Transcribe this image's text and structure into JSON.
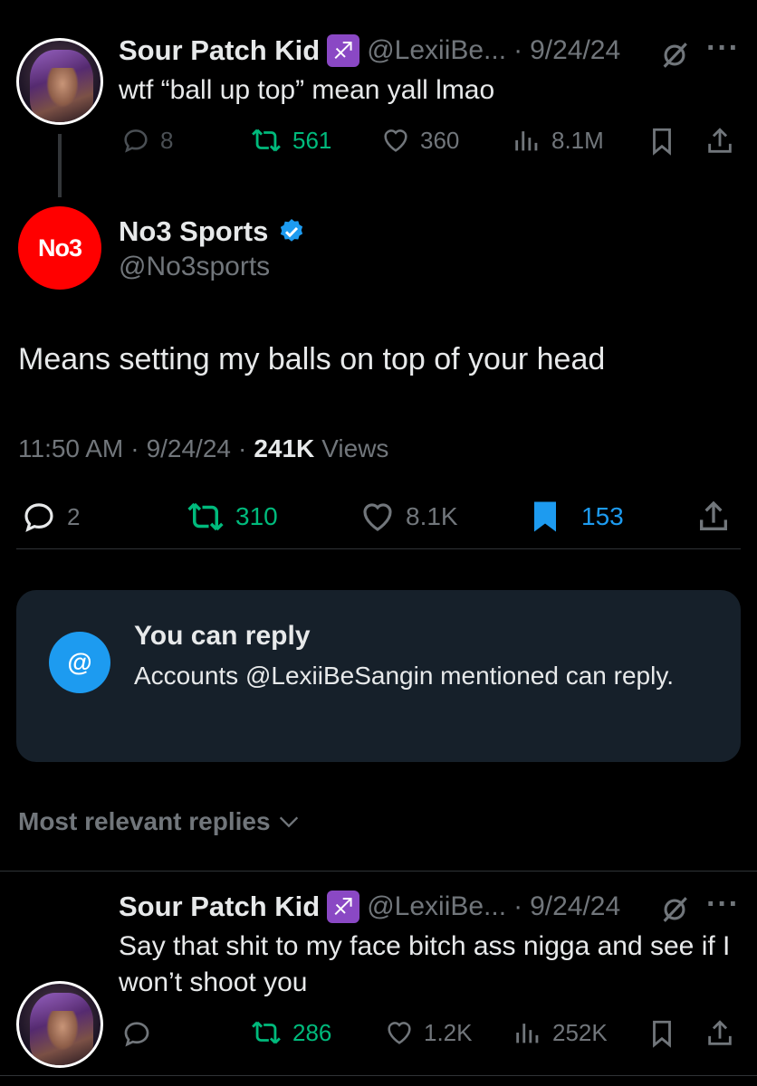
{
  "parent_tweet": {
    "author_name": "Sour Patch Kid",
    "zodiac_badge": "♐",
    "handle": "@LexiiBe...",
    "separator": "·",
    "date": "9/24/24",
    "text": "wtf “ball up top” mean yall lmao",
    "stats": {
      "replies": "8",
      "reposts": "561",
      "likes": "360",
      "views": "8.1M"
    }
  },
  "main_tweet": {
    "avatar_text": "No3",
    "author_name": "No3 Sports",
    "handle": "@No3sports",
    "text": "Means setting my balls on top of your head",
    "time": "11:50 AM",
    "separator": "·",
    "date": "9/24/24",
    "views_count": "241K",
    "views_label": "Views",
    "stats": {
      "replies": "2",
      "reposts": "310",
      "likes": "8.1K",
      "bookmarks": "153"
    }
  },
  "reply_restriction": {
    "title": "You can reply",
    "description": "Accounts @LexiiBeSangin mentioned can reply.",
    "icon_symbol": "@"
  },
  "sort_label": "Most relevant replies",
  "reply_tweet": {
    "author_name": "Sour Patch Kid",
    "zodiac_badge": "♐",
    "handle": "@LexiiBe...",
    "separator": "·",
    "date": "9/24/24",
    "text": "Say that shit to my face bitch ass nigga and see if I won’t shoot you",
    "stats": {
      "reposts": "286",
      "likes": "1.2K",
      "views": "252K"
    }
  },
  "colors": {
    "green": "#00ba7c",
    "blue": "#1d9bf0",
    "muted": "#71767b",
    "card_bg": "#16202a",
    "badge_red": "#ff0000"
  }
}
